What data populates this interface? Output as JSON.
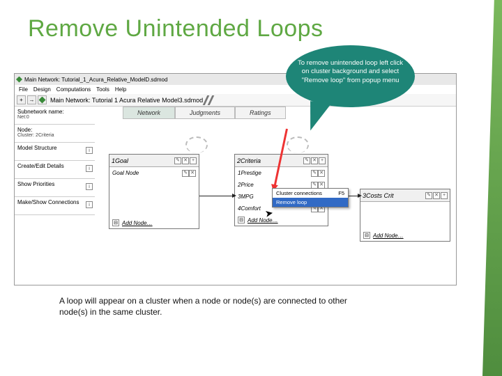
{
  "slide": {
    "title": "Remove Unintended Loops",
    "footnote": "A loop will appear on a cluster when a node or node(s) are connected to other node(s) in the same cluster."
  },
  "window": {
    "title1": "Main Network: Tutorial_1_Acura_Relative_ModelD.sdmod",
    "title2": "Main Network: Tutorial 1 Acura Relative Model3.sdmod"
  },
  "menu": {
    "file": "File",
    "design": "Design",
    "computations": "Computations",
    "tools": "Tools",
    "help": "Help"
  },
  "sidebar": {
    "row0_l1": "Subnetwork name:",
    "row0_l2": "Net:0",
    "row1_l1": "Node:",
    "row1_l2": "Cluster: 2Criteria",
    "row2": "Model Structure",
    "row3": "Create/Edit Details",
    "row4": "Show Priorities",
    "row5": "Make/Show Connections"
  },
  "tabs": {
    "network": "Network",
    "judgments": "Judgments",
    "ratings": "Ratings"
  },
  "clusters": {
    "goal": {
      "title": "1Goal",
      "node": "Goal Node",
      "add": "Add Node…"
    },
    "criteria": {
      "title": "2Criteria",
      "n1": "1Prestige",
      "n2": "2Price",
      "n3": "3MPG",
      "n4": "4Comfort",
      "add": "Add Node…"
    },
    "third": {
      "title": "3Costs Crit",
      "add": "Add Node…"
    }
  },
  "bubble": {
    "text": "To remove unintended loop left click on cluster background and select \"Remove loop\" from popup menu"
  },
  "popup": {
    "row1_l": "Cluster connections",
    "row1_r": "F5",
    "row2_l": "Remove loop",
    "row2_r": ""
  },
  "icons": {
    "plus": "+",
    "minus": "−",
    "arrow": "→",
    "x": "✕",
    "pencil": "✎",
    "collapse": "⊟"
  }
}
